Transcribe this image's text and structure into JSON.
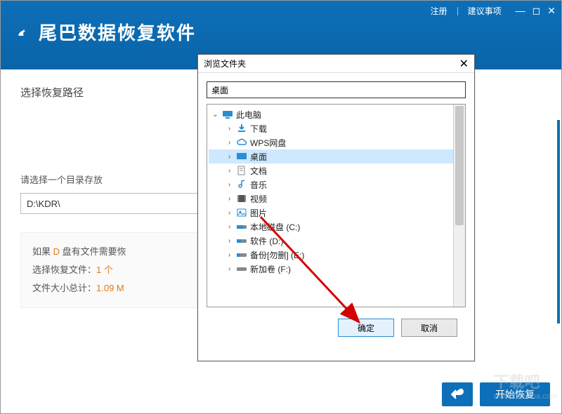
{
  "header": {
    "register": "注册",
    "suggestions": "建议事项",
    "app_title": "尾巴数据恢复软件"
  },
  "main": {
    "section_title": "选择恢复路径",
    "subtitle": "请选择一个目录存放",
    "path_value": "D:\\KDR\\",
    "info": {
      "line1_pre": "如果 ",
      "line1_drive": "D",
      "line1_post": " 盘有文件需要恢",
      "line2_pre": "选择恢复文件：",
      "line2_val": "1 个",
      "line3_pre": "文件大小总计：",
      "line3_val": "1.09 M"
    }
  },
  "footer": {
    "start": "开始恢复"
  },
  "dialog": {
    "title": "浏览文件夹",
    "selected": "桌面",
    "ok": "确定",
    "cancel": "取消",
    "tree": {
      "root": "此电脑",
      "downloads": "下载",
      "wps": "WPS网盘",
      "desktop": "桌面",
      "documents": "文档",
      "music": "音乐",
      "video": "视频",
      "pictures": "图片",
      "disk_c": "本地磁盘 (C:)",
      "disk_d": "软件 (D:)",
      "disk_e": "备份[勿删] (E:)",
      "disk_f": "新加卷 (F:)"
    }
  },
  "watermark": {
    "big": "下载吧",
    "small": "www.xiazaiba.com"
  }
}
